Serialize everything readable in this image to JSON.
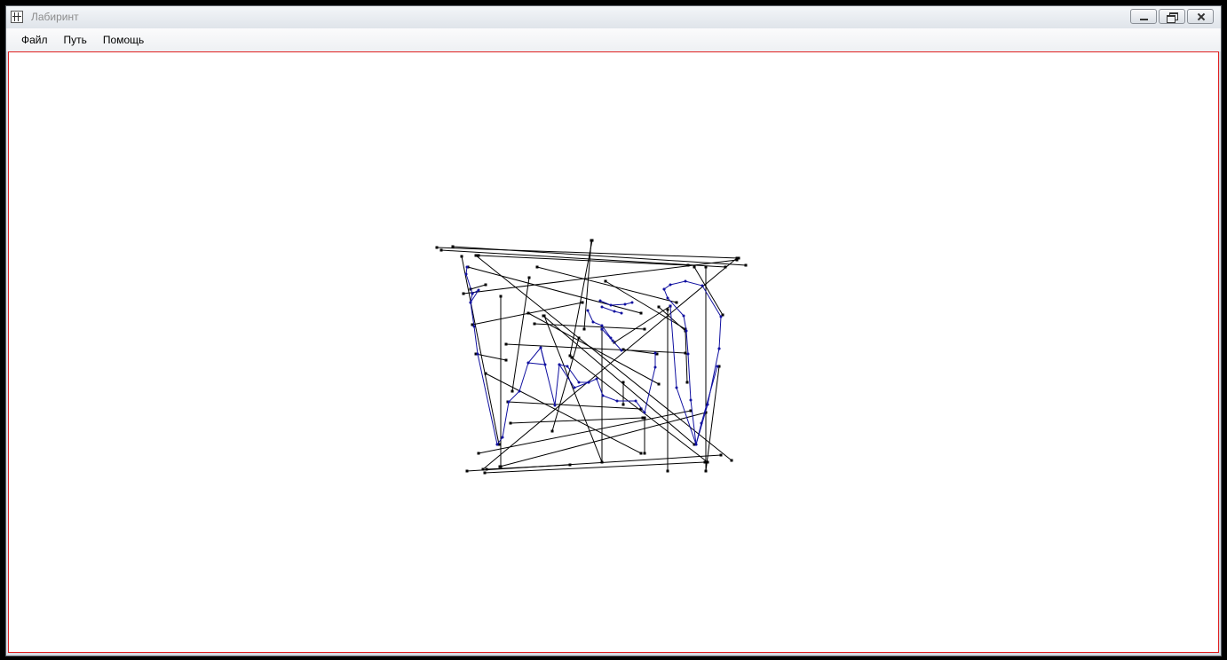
{
  "window": {
    "title": "Лабиринт",
    "icon": "maze-icon",
    "controls": [
      "minimize-icon",
      "restore-icon",
      "close-icon"
    ]
  },
  "menu": [
    "Файл",
    "Путь",
    "Помощь"
  ],
  "colors": {
    "frame": "#000000",
    "canvas_border": "#e02020",
    "edge": "#000000",
    "path": "#1010a0"
  }
}
